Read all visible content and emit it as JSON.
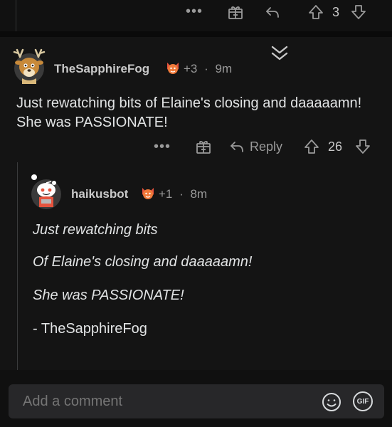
{
  "top_comment": {
    "vote_count": "3"
  },
  "comment": {
    "username": "TheSapphireFog",
    "karma": "+3",
    "separator": "·",
    "age": "9m",
    "body": "Just rewatching bits of Elaine's closing and daaaaamn! She was PASSIONATE!",
    "reply_label": "Reply",
    "vote_count": "26"
  },
  "reply": {
    "username": "haikusbot",
    "karma": "+1",
    "separator": "·",
    "age": "8m",
    "lines": [
      "Just rewatching bits",
      "Of Elaine's closing and daaaaamn!",
      "She was PASSIONATE!"
    ],
    "signature": "- TheSapphireFog"
  },
  "composer": {
    "placeholder": "Add a comment",
    "gif_label": "GIF"
  },
  "colors": {
    "background": "#101010",
    "text": "#e1e3e4",
    "muted": "#9a9a9a",
    "flair_orange": "#e5533d"
  }
}
